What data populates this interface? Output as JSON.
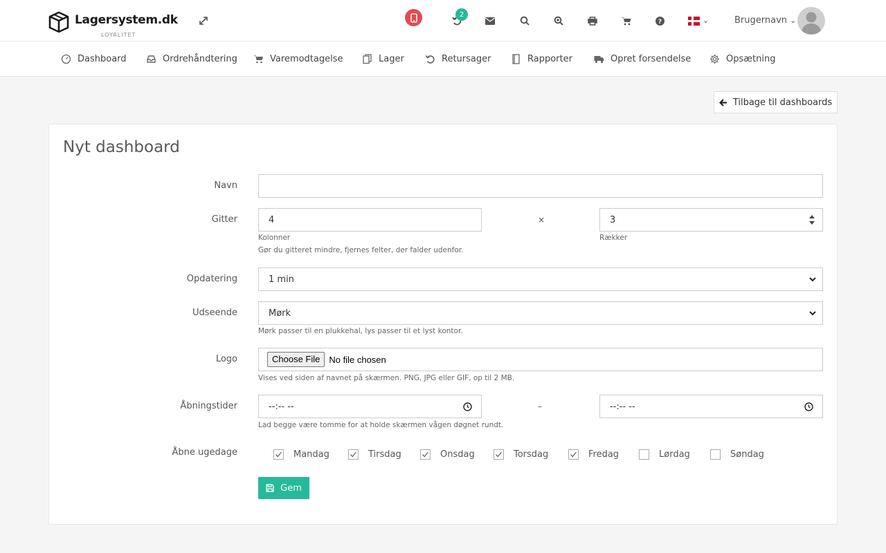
{
  "brand": {
    "name": "Lagersystem.dk",
    "tagline": "LOYALITET"
  },
  "topbar": {
    "notification_count": "2",
    "username": "Brugernavn",
    "icons": [
      "expand-icon",
      "mobile-icon",
      "undo-icon",
      "envelope-icon",
      "search-icon",
      "zoom-in-icon",
      "print-icon",
      "cart-icon",
      "help-icon",
      "flag-dk-icon",
      "user-avatar"
    ]
  },
  "nav": [
    {
      "label": "Dashboard",
      "icon": "gauge-icon"
    },
    {
      "label": "Ordrehåndtering",
      "icon": "inbox-icon"
    },
    {
      "label": "Varemodtagelse",
      "icon": "cart-icon"
    },
    {
      "label": "Lager",
      "icon": "copy-icon"
    },
    {
      "label": "Retursager",
      "icon": "undo-icon"
    },
    {
      "label": "Rapporter",
      "icon": "book-icon"
    },
    {
      "label": "Opret forsendelse",
      "icon": "truck-icon"
    },
    {
      "label": "Opsætning",
      "icon": "gear-icon"
    }
  ],
  "back_button": "Tilbage til dashboards",
  "form": {
    "title": "Nyt dashboard",
    "name": {
      "label": "Navn",
      "value": ""
    },
    "grid": {
      "label": "Gitter",
      "columns": "4",
      "rows": "3",
      "separator": "×",
      "columns_label": "Kolonner",
      "rows_label": "Rækker",
      "hint": "Gør du gitteret mindre, fjernes felter, der falder udenfor."
    },
    "refresh": {
      "label": "Opdatering",
      "value": "1 min"
    },
    "appearance": {
      "label": "Udseende",
      "value": "Mørk",
      "hint": "Mørk passer til en plukkehal, lys passer til et lyst kontor."
    },
    "logo": {
      "label": "Logo",
      "button": "Choose File",
      "status": "No file chosen",
      "hint": "Vises ved siden af navnet på skærmen. PNG, JPG eller GIF, op til 2 MB."
    },
    "hours": {
      "label": "Åbningstider",
      "from": "--:-- --",
      "to": "--:-- --",
      "separator": "–",
      "hint": "Lad begge være tomme for at holde skærmen vågen døgnet rundt."
    },
    "weekdays": {
      "label": "Åbne ugedage",
      "days": [
        {
          "label": "Mandag",
          "checked": true
        },
        {
          "label": "Tirsdag",
          "checked": true
        },
        {
          "label": "Onsdag",
          "checked": true
        },
        {
          "label": "Torsdag",
          "checked": true
        },
        {
          "label": "Fredag",
          "checked": true
        },
        {
          "label": "Lørdag",
          "checked": false
        },
        {
          "label": "Søndag",
          "checked": false
        }
      ]
    },
    "save_button": "Gem"
  },
  "colors": {
    "accent": "#26b99a",
    "badge_red": "#e9484f"
  }
}
